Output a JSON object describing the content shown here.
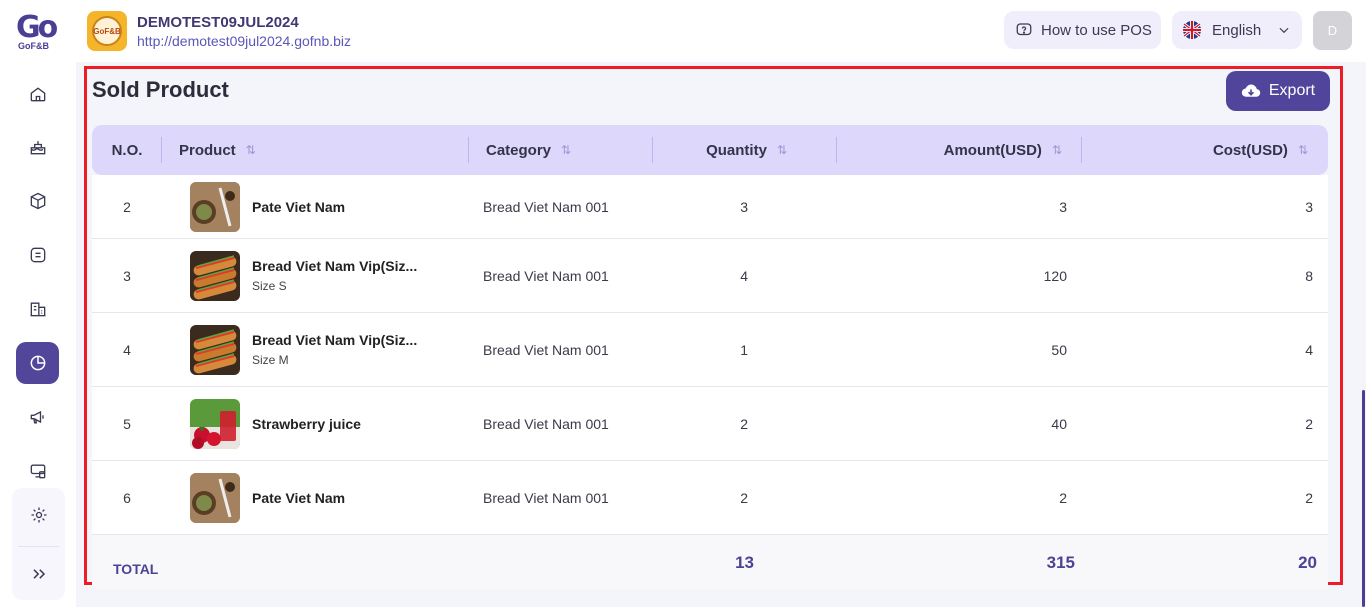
{
  "app": {
    "logo_text": "Go",
    "logo_sub": "GoF&B"
  },
  "header": {
    "store_name": "DEMOTEST09JUL2024",
    "store_url": "http://demotest09jul2024.gofnb.biz",
    "store_logo_text": "GoF&B",
    "how_to_use": "How to use POS",
    "language": "English",
    "avatar_initial": "D"
  },
  "nav_icons": [
    "home-icon",
    "cake-icon",
    "box-icon",
    "list-icon",
    "building-icon",
    "report-pie-icon",
    "megaphone-icon",
    "pos-device-icon",
    "settings-gear-icon",
    "expand-icon"
  ],
  "panel": {
    "title": "Sold Product",
    "export_label": "Export"
  },
  "table": {
    "columns": [
      "N.O.",
      "Product",
      "Category",
      "Quantity",
      "Amount(USD)",
      "Cost(USD)"
    ],
    "rows": [
      {
        "no": "2",
        "product": "Pate Viet Nam",
        "variant": "",
        "category": "Bread Viet Nam 001",
        "quantity": "3",
        "amount": "3",
        "cost": "3",
        "image": "pate"
      },
      {
        "no": "3",
        "product": "Bread Viet Nam Vip(Siz...",
        "variant": "Size S",
        "category": "Bread Viet Nam 001",
        "quantity": "4",
        "amount": "120",
        "cost": "8",
        "image": "bread"
      },
      {
        "no": "4",
        "product": "Bread Viet Nam Vip(Siz...",
        "variant": "Size M",
        "category": "Bread Viet Nam 001",
        "quantity": "1",
        "amount": "50",
        "cost": "4",
        "image": "bread"
      },
      {
        "no": "5",
        "product": "Strawberry juice",
        "variant": "",
        "category": "Bread Viet Nam 001",
        "quantity": "2",
        "amount": "40",
        "cost": "2",
        "image": "strawberry"
      },
      {
        "no": "6",
        "product": "Pate Viet Nam",
        "variant": "",
        "category": "Bread Viet Nam 001",
        "quantity": "2",
        "amount": "2",
        "cost": "2",
        "image": "pate"
      }
    ],
    "total": {
      "label": "TOTAL",
      "quantity": "13",
      "amount": "315",
      "cost": "20"
    }
  },
  "colors": {
    "accent": "#50459a",
    "header_row": "#dcd7fb",
    "highlight_border": "#ee1c24"
  }
}
